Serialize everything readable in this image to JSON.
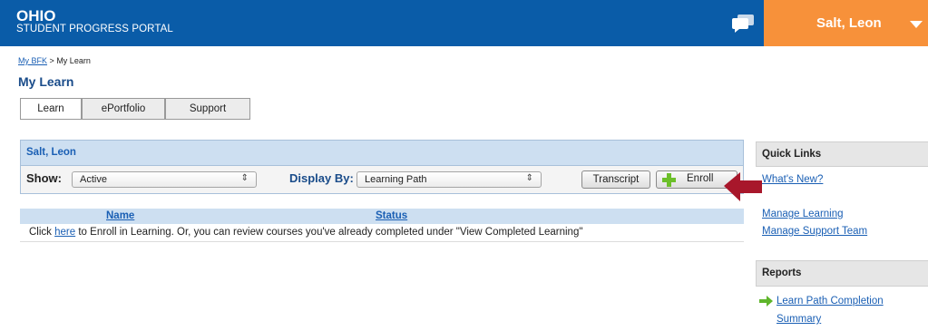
{
  "header": {
    "brand_title": "OHIO",
    "brand_subtitle": "STUDENT PROGRESS PORTAL",
    "chat_icon": "chat-bubbles-icon",
    "user_name": "Salt, Leon",
    "user_menu_color": "#f7913a",
    "bar_color": "#0a5ca8"
  },
  "breadcrumb": {
    "root_link": "My BFK",
    "separator": ">",
    "current": "My Learn"
  },
  "page": {
    "title": "My Learn"
  },
  "tabs": [
    {
      "label": "Learn",
      "active": true
    },
    {
      "label": "ePortfolio",
      "active": false
    },
    {
      "label": "Support",
      "active": false
    }
  ],
  "panel": {
    "title": "Salt, Leon",
    "show_label": "Show:",
    "show_value": "Active",
    "display_label": "Display By:",
    "display_value": "Learning Path",
    "transcript_button": "Transcript",
    "enroll_button": "Enroll"
  },
  "results": {
    "columns": [
      "Name",
      "Status"
    ],
    "message_prefix": "Click",
    "message_link": "here",
    "message_suffix": "to Enroll in Learning. Or, you can review courses you've already completed under \"View Completed Learning\""
  },
  "quick_links": {
    "title": "Quick Links",
    "links": [
      "What's New?",
      "Manage Learning",
      "Manage Support Team"
    ]
  },
  "reports": {
    "title": "Reports",
    "links": [
      "Learn Path Completion",
      "Summary"
    ]
  }
}
